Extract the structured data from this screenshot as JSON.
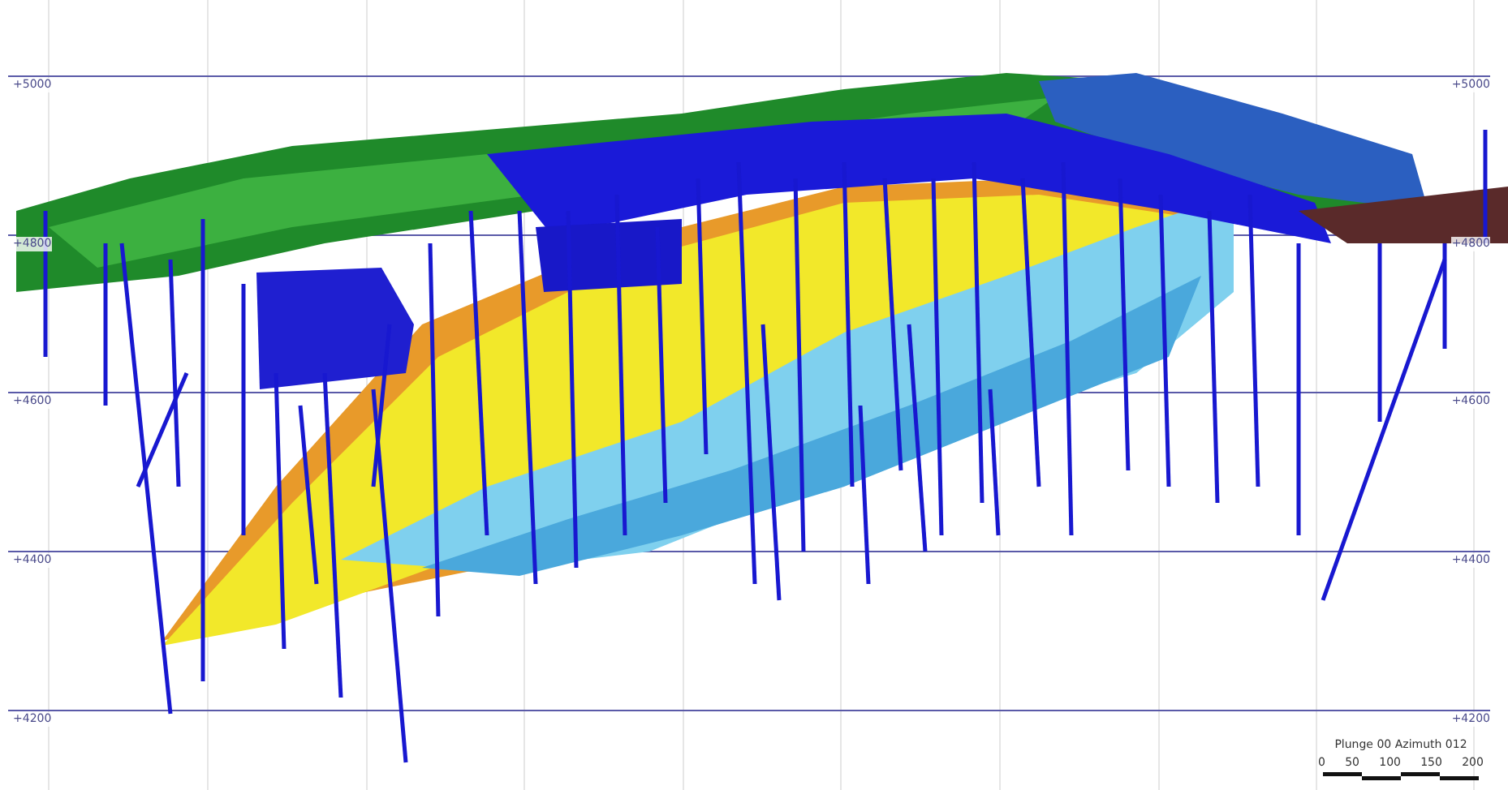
{
  "elevation_labels_left": [
    "+5000",
    "+4800",
    "+4600",
    "+4400",
    "+4200"
  ],
  "elevation_labels_right": [
    "+5000",
    "+4800",
    "+4600",
    "+4400",
    "+4200"
  ],
  "view_caption": "Plunge 00 Azimuth 012",
  "scale_bar": {
    "ticks": [
      "0",
      "50",
      "100",
      "150",
      "200"
    ]
  }
}
